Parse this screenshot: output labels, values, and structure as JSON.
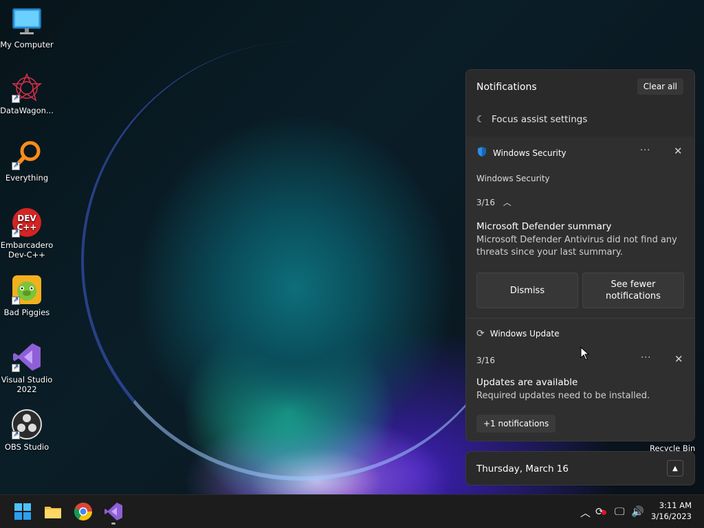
{
  "desktop": {
    "icons": [
      {
        "label": "My Computer",
        "icon": "monitor-icon"
      },
      {
        "label": "DataWagon...",
        "icon": "datawagon-icon"
      },
      {
        "label": "Everything",
        "icon": "search-magnifier-icon"
      },
      {
        "label": "Embarcadero Dev-C++",
        "icon": "devcpp-icon",
        "badge": "DEV C++"
      },
      {
        "label": "Bad Piggies",
        "icon": "bad-piggies-icon"
      },
      {
        "label": "Visual Studio 2022",
        "icon": "visual-studio-icon"
      },
      {
        "label": "OBS Studio",
        "icon": "obs-icon"
      }
    ],
    "recycle_bin": "Recycle Bin"
  },
  "notifications": {
    "title": "Notifications",
    "clear_all": "Clear all",
    "focus_assist": "Focus assist settings",
    "cards": [
      {
        "app": "Windows Security",
        "subtitle": "Windows Security",
        "date": "3/16",
        "heading": "Microsoft Defender summary",
        "body": "Microsoft Defender Antivirus did not find any threats since your last summary.",
        "buttons": [
          "Dismiss",
          "See fewer notifications"
        ]
      },
      {
        "app": "Windows Update",
        "date": "3/16",
        "heading": "Updates are available",
        "body": "Required updates need to be installed.",
        "more": "+1 notifications"
      }
    ]
  },
  "calendar": {
    "date": "Thursday, March 16"
  },
  "taskbar": {
    "time": "3:11 AM",
    "date": "3/16/2023"
  },
  "colors": {
    "accent": "#0078d4",
    "panel": "#2a2a2a"
  }
}
